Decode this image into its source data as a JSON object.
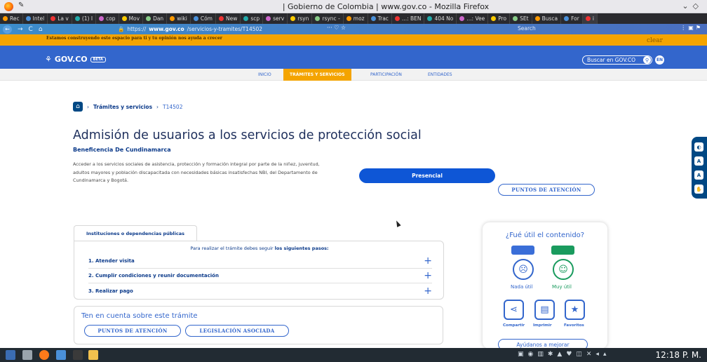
{
  "browser": {
    "window_title": "| Gobierno de Colombia | www.gov.co - Mozilla Firefox",
    "tabs": [
      "Rec",
      "Intel",
      "La v",
      "(1) I",
      "cop",
      "Mov",
      "Dan",
      "wiki",
      "Cóm",
      "New",
      "scp",
      "serv",
      "rsyn",
      "rsync -",
      "moz",
      "Trac",
      "...: BEN",
      "404 No",
      "...: Vee",
      "Pro",
      "SEt",
      "Busca",
      "For",
      "i"
    ],
    "url_prefix": "https://",
    "url_domain": "www.gov.co",
    "url_path": "/servicios-y-tramites/T14502",
    "page_actions": "··· ♡ ☆",
    "search_placeholder": "Search"
  },
  "notice": {
    "message": "Estamos construyendo este espacio para ti y tu opinión nos ayuda a crecer",
    "clear": "clear"
  },
  "gov_header": {
    "logo": "GOV.CO",
    "beta": "BETA",
    "search_label": "Buscar en GOV.CO",
    "lang": "EN"
  },
  "menu": {
    "items": [
      "INICIO",
      "TRÁMITES Y SERVICIOS",
      "PARTICIPACIÓN",
      "ENTIDADES"
    ]
  },
  "breadcrumb": {
    "section": "Trámites y servicios",
    "current": "T14502"
  },
  "page": {
    "title": "Admisión de usuarios a los servicios de protección social",
    "entity": "Beneficencia De Cundinamarca",
    "description": "Acceder a los servicios sociales de asistencia, protección y formación integral por parte de la niñez, juventud, adultos mayores y población discapacitada con necesidades básicas insatisfechas NBI, del Departamento de Cundinamarca y Bogotá.",
    "presencial_label": "Presencial",
    "puntos_atencion": "PUNTOS DE ATENCIÓN"
  },
  "steps": {
    "tab_label": "Instituciones o dependencias públicas",
    "intro_prefix": "Para realizar el trámite debes seguir",
    "intro_bold": "los siguientes pasos:",
    "items": [
      "1. Atender visita",
      "2. Cumplir condiciones y reunir documentación",
      "3. Realizar pago"
    ]
  },
  "tener": {
    "title": "Ten en cuenta sobre este trámite",
    "btn1": "PUNTOS DE ATENCIÓN",
    "btn2": "LEGISLACIÓN ASOCIADA"
  },
  "feedback": {
    "question": "¿Fué útil el contenido?",
    "nada": "Nada útil",
    "muy": "Muy útil",
    "compartir": "Compartir",
    "imprimir": "Imprimir",
    "favoritos": "Favoritos",
    "ayudanos": "Ayúdanos a mejorar"
  },
  "taskbar": {
    "clock": "12:18 P. M."
  },
  "colors": {
    "gov_blue": "#3366cc",
    "accent_orange": "#f4a400",
    "dark_blue": "#004884"
  }
}
